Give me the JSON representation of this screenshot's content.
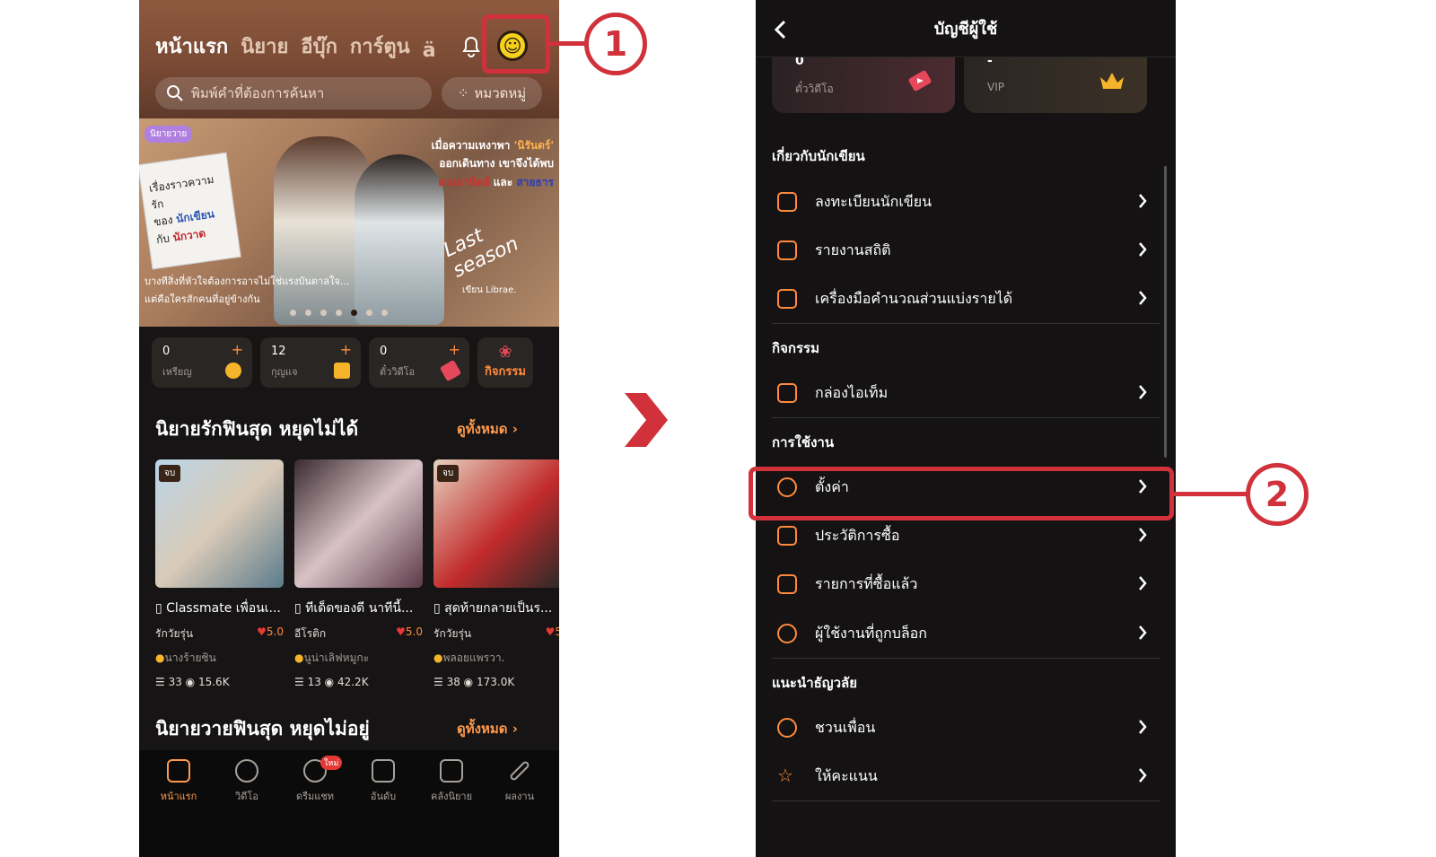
{
  "left": {
    "tabs": [
      "หน้าแรก",
      "นิยาย",
      "อีบุ๊ก",
      "การ์ตูน",
      "ä"
    ],
    "search_placeholder": "พิมพ์คำที่ต้องการค้นหา",
    "category_button": "หมวดหมู่",
    "banner": {
      "tag": "นิยายวาย",
      "note_line1": "เรื่องราวความรัก",
      "note_line2a": "ของ ",
      "note_line2b": "นักเขียน",
      "note_line3a": "กับ ",
      "note_line3b": "นักวาด",
      "line1a": "เมื่อความเหงาพา ",
      "line1b": "'นิรันดร์'",
      "line2": "ออกเดินทาง เขาจึงได้พบ",
      "line3a": "ดวงอาทิตย์",
      "line3b": " และ ",
      "line3c": "สายธาร",
      "sub1": "บางทีสิ่งที่หัวใจต้องการอาจไม่ใช่แรงบันดาลใจ...",
      "sub2": "แต่คือใครสักคนที่อยู่ข้างกัน",
      "script_title": "Last season",
      "author": "เขียน Librae."
    },
    "stats": [
      {
        "value": "0",
        "label": "เหรียญ"
      },
      {
        "value": "12",
        "label": "กุญแจ"
      },
      {
        "value": "0",
        "label": "ตั๋ววิดีโอ"
      }
    ],
    "activity_label": "กิจกรรม",
    "section1_title": "นิยายรักฟินสุด หยุดไม่ได้",
    "section_more": "ดูทั้งหมด",
    "books": [
      {
        "badge": "จบ",
        "title": "Classmate เพื่อนเ...",
        "genre": "รักวัยรุ่น",
        "rating": "5.0",
        "author": "นางร้ายซิน",
        "chapters": "33",
        "views": "15.6K"
      },
      {
        "badge": "",
        "title": "ทีเด็ดของดี นาทีนี้...",
        "genre": "อีโรติก",
        "rating": "5.0",
        "author": "นูน่าเลิฟหมูกะ",
        "chapters": "13",
        "views": "42.2K"
      },
      {
        "badge": "จบ",
        "title": "สุดท้ายกลายเป็นร...",
        "genre": "รักวัยรุ่น",
        "rating": "5",
        "author": "พลอยแพรวา.",
        "chapters": "38",
        "views": "173.0K"
      }
    ],
    "section2_title": "นิยายวายฟินสุด หยุดไม่อยู่",
    "nav": [
      {
        "label": "หน้าแรก",
        "icon": "home-icon"
      },
      {
        "label": "วิดีโอ",
        "icon": "video-icon"
      },
      {
        "label": "ดรีมแชท",
        "icon": "chat-icon",
        "badge": "ใหม่"
      },
      {
        "label": "อันดับ",
        "icon": "trophy-icon"
      },
      {
        "label": "คลังนิยาย",
        "icon": "library-icon"
      },
      {
        "label": "ผลงาน",
        "icon": "pen-icon"
      }
    ]
  },
  "callouts": {
    "one": "1",
    "two": "2"
  },
  "right": {
    "title": "บัญชีผู้ใช้",
    "card1": {
      "value": "0",
      "label": "ตั๋ววิดีโอ"
    },
    "card2": {
      "value": "-",
      "label": "VIP"
    },
    "sections": [
      {
        "title": "เกี่ยวกับนักเขียน",
        "items": [
          "ลงทะเบียนนักเขียน",
          "รายงานสถิติ",
          "เครื่องมือคำนวณส่วนแบ่งรายได้"
        ]
      },
      {
        "title": "กิจกรรม",
        "items": [
          "กล่องไอเท็ม"
        ]
      },
      {
        "title": "การใช้งาน",
        "items": [
          "ตั้งค่า",
          "ประวัติการซื้อ",
          "รายการที่ซื้อแล้ว",
          "ผู้ใช้งานที่ถูกบล็อก"
        ]
      },
      {
        "title": "แนะนำธัญวลัย",
        "items": [
          "ชวนเพื่อน",
          "ให้คะแนน"
        ]
      }
    ]
  },
  "colors": {
    "accent": "#ff8a3d",
    "callout": "#d0313b",
    "background": "#141212"
  }
}
